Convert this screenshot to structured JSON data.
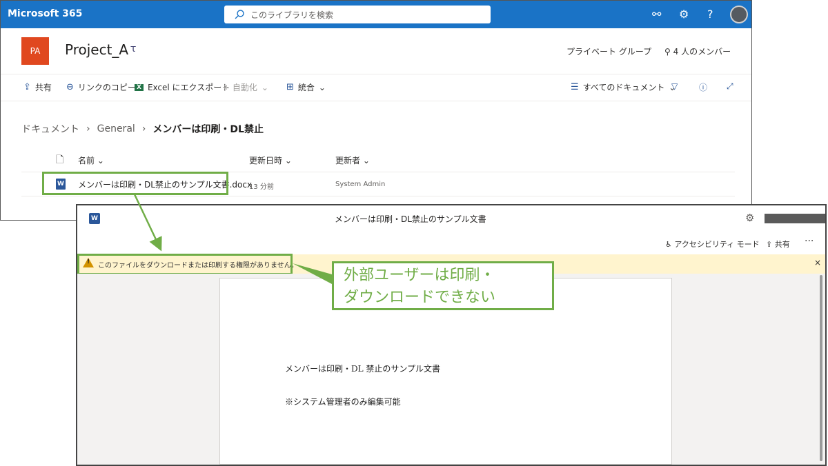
{
  "sharepoint": {
    "brand": "Microsoft 365",
    "search_placeholder": "このライブラリを検索",
    "site_logo_text": "PA",
    "site_title": "Project_A",
    "privacy": "プライベート グループ",
    "members": "4 人のメンバー",
    "commands": {
      "share": "共有",
      "copy_link": "リンクのコピー",
      "export_excel": "Excel にエクスポート",
      "automate": "自動化",
      "integrate": "統合",
      "view": "すべてのドキュメント"
    },
    "breadcrumb": [
      "ドキュメント",
      "General",
      "メンバーは印刷・DL禁止"
    ],
    "columns": {
      "name": "名前",
      "modified": "更新日時",
      "modified_by": "更新者"
    },
    "files": [
      {
        "name": "メンバーは印刷・DL禁止のサンプル文書.docx",
        "modified": "13 分前",
        "modified_by": "System Admin"
      }
    ]
  },
  "word": {
    "doc_title": "メンバーは印刷・DL禁止のサンプル文書",
    "accessibility_mode": "アクセシビリティ モード",
    "share": "共有",
    "more": "···",
    "message": "このファイルをダウンロードまたは印刷する権限がありません。",
    "close": "×",
    "body_line1": "メンバーは印刷・DL 禁止のサンプル文書",
    "body_line2": "※システム管理者のみ編集可能"
  },
  "callout": {
    "line1": "外部ユーザーは印刷・",
    "line2": "ダウンロードできない"
  },
  "colors": {
    "suite_bar": "#1a73c6",
    "site_logo": "#e0481f",
    "highlight": "#70ad47",
    "message_bar": "#fff4ce",
    "word_blue": "#2b579a"
  }
}
